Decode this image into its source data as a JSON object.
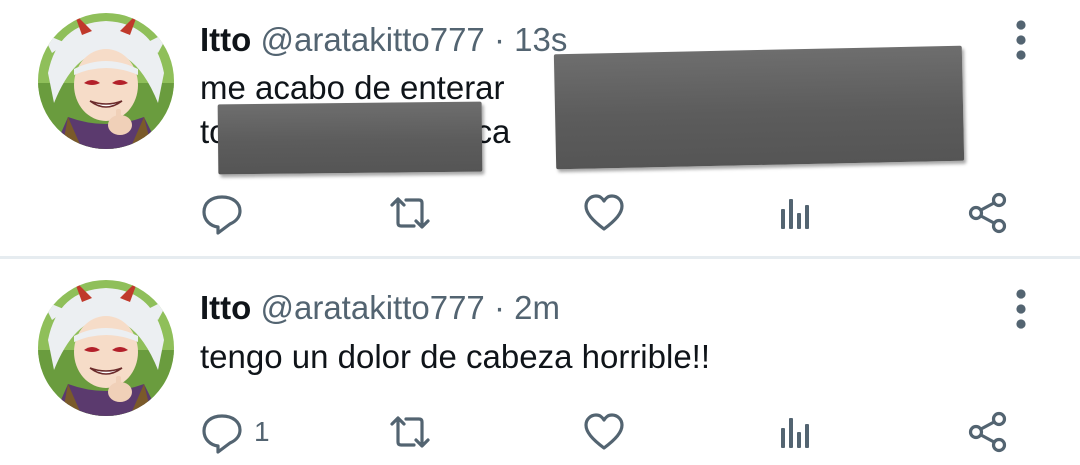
{
  "colors": {
    "text_primary": "#0f1419",
    "text_secondary": "#536471",
    "divider": "#e6ecf0",
    "redaction": "#5f5f5f"
  },
  "tweets": [
    {
      "name": "Itto",
      "handle": "@aratakitto777",
      "separator": "·",
      "time": "13s",
      "text_line_1": "me acabo de enterar",
      "text_line_2_start": "to",
      "text_line_2_end": "ca",
      "redacted": true,
      "avatar_icon": "itto-avatar",
      "menu_icon": "more-vertical-icon",
      "actions": {
        "reply": {
          "icon": "reply-icon",
          "count": ""
        },
        "retweet": {
          "icon": "retweet-icon",
          "count": ""
        },
        "like": {
          "icon": "heart-icon",
          "count": ""
        },
        "stats": {
          "icon": "analytics-icon",
          "count": ""
        },
        "share": {
          "icon": "share-icon",
          "count": ""
        }
      }
    },
    {
      "name": "Itto",
      "handle": "@aratakitto777",
      "separator": "·",
      "time": "2m",
      "text_line_1": "tengo un dolor de cabeza horrible!!",
      "avatar_icon": "itto-avatar",
      "menu_icon": "more-vertical-icon",
      "actions": {
        "reply": {
          "icon": "reply-icon",
          "count": "1"
        },
        "retweet": {
          "icon": "retweet-icon",
          "count": ""
        },
        "like": {
          "icon": "heart-icon",
          "count": ""
        },
        "stats": {
          "icon": "analytics-icon",
          "count": ""
        },
        "share": {
          "icon": "share-icon",
          "count": ""
        }
      }
    }
  ]
}
